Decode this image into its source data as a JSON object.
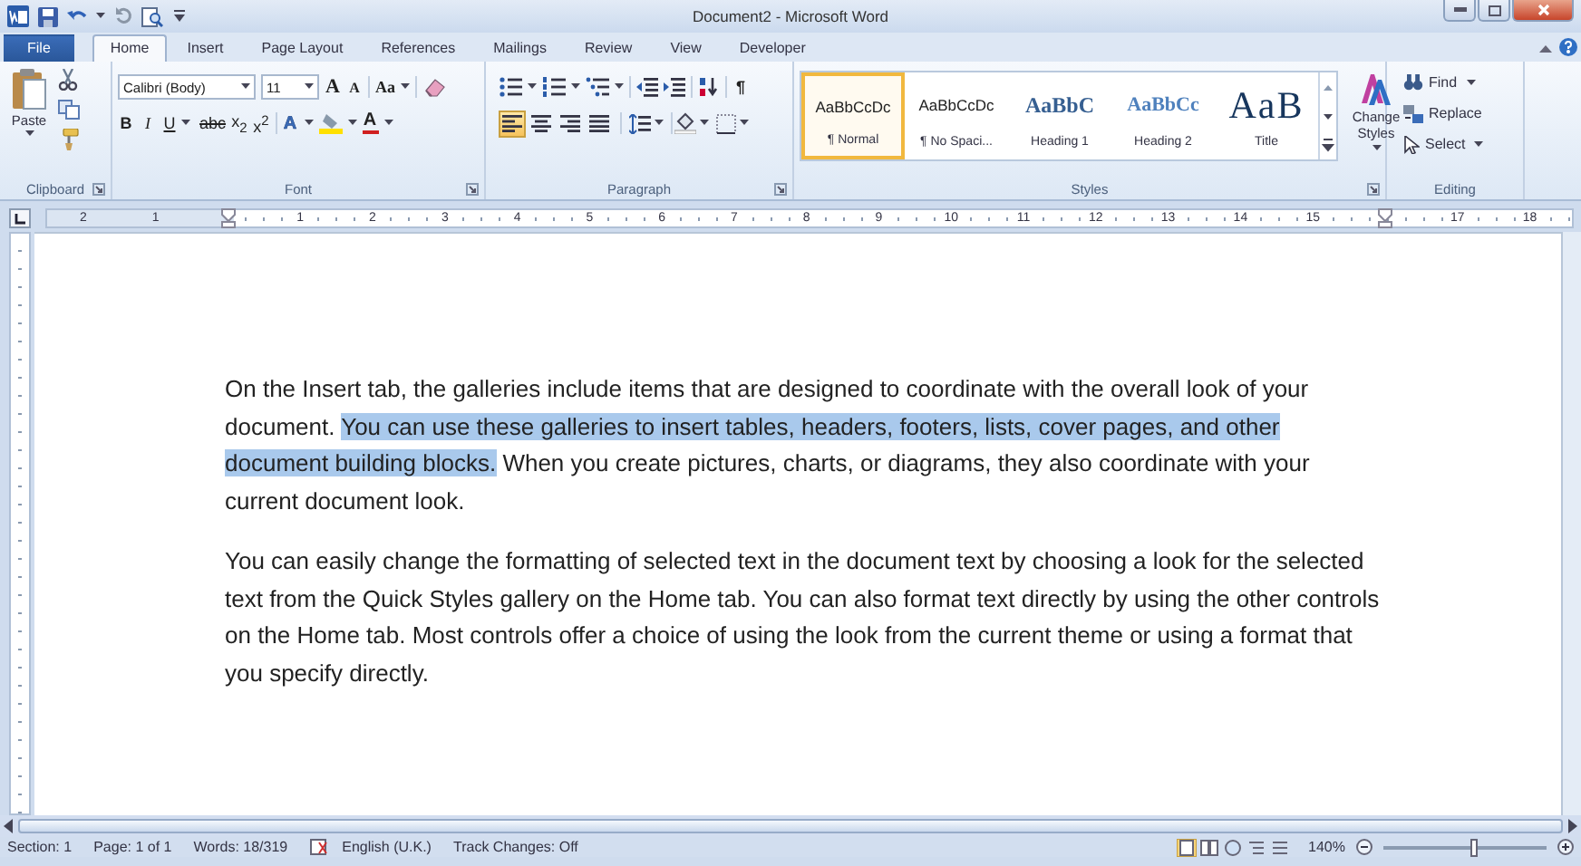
{
  "title_bar": {
    "title": "Document2 - Microsoft Word"
  },
  "tabs": [
    {
      "label": "File",
      "kind": "file",
      "selected": false
    },
    {
      "label": "Home",
      "kind": "tab",
      "selected": true
    },
    {
      "label": "Insert",
      "kind": "tab",
      "selected": false
    },
    {
      "label": "Page Layout",
      "kind": "tab",
      "selected": false
    },
    {
      "label": "References",
      "kind": "tab",
      "selected": false
    },
    {
      "label": "Mailings",
      "kind": "tab",
      "selected": false
    },
    {
      "label": "Review",
      "kind": "tab",
      "selected": false
    },
    {
      "label": "View",
      "kind": "tab",
      "selected": false
    },
    {
      "label": "Developer",
      "kind": "tab",
      "selected": false
    }
  ],
  "clipboard": {
    "paste": "Paste",
    "group_label": "Clipboard"
  },
  "font": {
    "name": "Calibri (Body)",
    "size": "11",
    "grow": "A",
    "shrink": "A",
    "change_case": "Aa",
    "format_buttons": [
      {
        "label": "B",
        "kind": "bold",
        "dropdown": false
      },
      {
        "label": "I",
        "kind": "italic",
        "dropdown": false
      },
      {
        "label": "U",
        "kind": "underline",
        "dropdown": true
      },
      {
        "label": "abc",
        "kind": "strike",
        "dropdown": false
      },
      {
        "label": "x$_{2}$",
        "kind": "plain",
        "dropdown": false
      },
      {
        "label": "x$^{2}$",
        "kind": "plain",
        "dropdown": false
      }
    ],
    "text_effects": "A",
    "font_color": "A",
    "group_label": "Font"
  },
  "paragraph": {
    "show_marks": "¶",
    "alignment": [
      {
        "kind": "left",
        "selected": true
      },
      {
        "kind": "center",
        "selected": false
      },
      {
        "kind": "right",
        "selected": false
      },
      {
        "kind": "justify",
        "selected": false
      }
    ],
    "group_label": "Paragraph"
  },
  "styles": {
    "items": [
      {
        "preview": "AaBbCcDc",
        "label": "¶ Normal",
        "kind": "normal",
        "selected": true
      },
      {
        "preview": "AaBbCcDc",
        "label": "¶ No Spaci...",
        "kind": "normal",
        "selected": false
      },
      {
        "preview": "AaBbC",
        "label": "Heading 1",
        "kind": "heading1",
        "selected": false
      },
      {
        "preview": "AaBbCc",
        "label": "Heading 2",
        "kind": "heading2",
        "selected": false
      },
      {
        "preview": "AaB",
        "label": "Title",
        "kind": "title",
        "selected": false
      }
    ],
    "change_styles": "Change Styles",
    "group_label": "Styles"
  },
  "editing": {
    "items": [
      {
        "label": "Find",
        "kind": "find",
        "dropdown": true
      },
      {
        "label": "Replace",
        "kind": "replace",
        "dropdown": false
      },
      {
        "label": "Select",
        "kind": "select",
        "dropdown": true
      }
    ],
    "group_label": "Editing"
  },
  "ruler": {
    "left_labels": [
      "2",
      "1"
    ],
    "labels": [
      "1",
      "2",
      "3",
      "4",
      "5",
      "6",
      "7",
      "8",
      "9",
      "10",
      "11",
      "12",
      "13",
      "14",
      "15"
    ],
    "end_labels": [
      "17",
      "18"
    ]
  },
  "document": {
    "paragraphs": [
      {
        "segments": [
          {
            "text": "On the Insert tab, the galleries include items that are designed to coordinate with the overall look of your document. ",
            "selected": false
          },
          {
            "text": "You can use these galleries to insert tables, headers, footers, lists, cover pages, and other document building blocks.",
            "selected": true
          },
          {
            "text": " When you create pictures, charts, or diagrams, they also coordinate with your current document look.",
            "selected": false
          }
        ]
      },
      {
        "segments": [
          {
            "text": "You can easily change the formatting of selected text in the document text by choosing a look for the selected text from the Quick Styles gallery on the Home tab. You can also format text directly by using the other controls on the Home tab. Most controls offer a choice of using the look from the current theme or using a format that you specify directly.",
            "selected": false
          }
        ]
      }
    ]
  },
  "status_bar": {
    "items": [
      "Section: 1",
      "Page: 1 of 1",
      "Words: 18/319",
      "English (U.K.)",
      "Track Changes: Off"
    ],
    "views": [
      {
        "kind": "print",
        "selected": true
      },
      {
        "kind": "fullscreen",
        "selected": false
      },
      {
        "kind": "web",
        "selected": false
      },
      {
        "kind": "outline",
        "selected": false
      },
      {
        "kind": "draft",
        "selected": false
      }
    ],
    "zoom": {
      "reading": "140%",
      "level": 0.55
    }
  }
}
